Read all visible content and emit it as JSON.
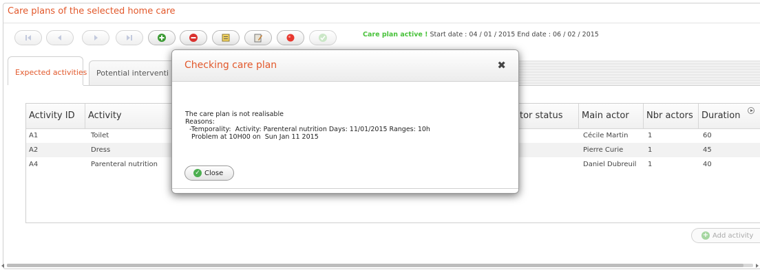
{
  "panel": {
    "title": "Care plans of the selected home care"
  },
  "toolbar": {
    "buttons": [
      {
        "name": "first-icon",
        "enabled": false
      },
      {
        "name": "previous-icon",
        "enabled": false
      },
      {
        "name": "next-icon",
        "enabled": false
      },
      {
        "name": "last-icon",
        "enabled": false
      },
      {
        "name": "add-icon",
        "enabled": true
      },
      {
        "name": "remove-icon",
        "enabled": true
      },
      {
        "name": "edit-icon",
        "enabled": true
      },
      {
        "name": "notepad-icon",
        "enabled": true
      },
      {
        "name": "record-icon",
        "enabled": true
      },
      {
        "name": "validate-icon",
        "enabled": false
      }
    ]
  },
  "status": {
    "active_label": "Care plan active !",
    "dates": "Start date : 04 / 01 / 2015  End date : 06 / 02 / 2015"
  },
  "tabs": [
    {
      "label": "Expected activities",
      "active": true
    },
    {
      "label": "Potential interventi",
      "active": false
    }
  ],
  "grid": {
    "columns": [
      "Activity ID",
      "Activity",
      "tor status",
      "Main actor",
      "Nbr actors",
      "Duration"
    ],
    "rows": [
      {
        "id": "A1",
        "activity": "Toilet",
        "main_actor": "Cécile Martin",
        "nbr_actors": "1",
        "duration": "60"
      },
      {
        "id": "A2",
        "activity": "Dress",
        "main_actor": "Pierre Curie",
        "nbr_actors": "1",
        "duration": "45"
      },
      {
        "id": "A4",
        "activity": "Parenteral nutrition",
        "main_actor": "Daniel Dubreuil",
        "nbr_actors": "1",
        "duration": "40"
      }
    ]
  },
  "add_activity_label": "Add activity",
  "dialog": {
    "title": "Checking care plan",
    "close_glyph": "✖",
    "message": "The care plan is not realisable\nReasons:\n  -Temporality:  Activity: Parenteral nutrition Days: 11/01/2015 Ranges: 10h\n   Problem at 10H00 on  Sun Jan 11 2015",
    "button_label": "Close"
  },
  "colors": {
    "accent": "#e2582b",
    "active_status": "#49c23b"
  }
}
